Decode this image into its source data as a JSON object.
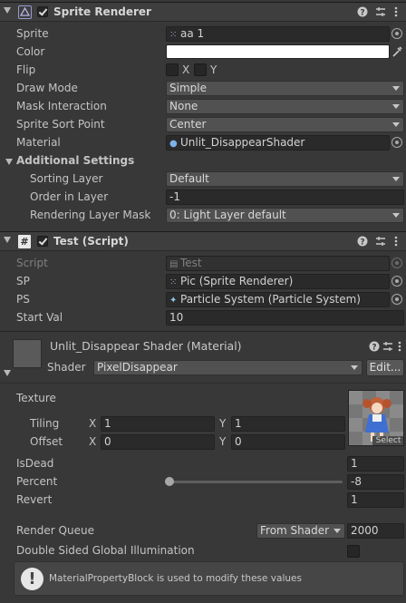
{
  "sprite_renderer": {
    "title": "Sprite Renderer",
    "enabled": true,
    "fields": {
      "sprite_label": "Sprite",
      "sprite_value": "aa 1",
      "color_label": "Color",
      "color_value": "#FFFFFF",
      "flip_label": "Flip",
      "flip_x": "X",
      "flip_y": "Y",
      "draw_mode_label": "Draw Mode",
      "draw_mode_value": "Simple",
      "mask_label": "Mask Interaction",
      "mask_value": "None",
      "sort_point_label": "Sprite Sort Point",
      "sort_point_value": "Center",
      "material_label": "Material",
      "material_value": "Unlit_DisappearShader"
    },
    "additional": {
      "title": "Additional Settings",
      "sorting_layer_label": "Sorting Layer",
      "sorting_layer_value": "Default",
      "order_label": "Order in Layer",
      "order_value": "-1",
      "rendering_layer_label": "Rendering Layer Mask",
      "rendering_layer_value": "0: Light Layer default"
    }
  },
  "test_script": {
    "title": "Test (Script)",
    "enabled": true,
    "script_label": "Script",
    "script_value": "Test",
    "sp_label": "SP",
    "sp_value": "Pic (Sprite Renderer)",
    "ps_label": "PS",
    "ps_value": "Particle System (Particle System)",
    "start_label": "Start Val",
    "start_value": "10"
  },
  "material": {
    "title": "Unlit_Disappear Shader (Material)",
    "shader_label": "Shader",
    "shader_value": "PixelDisappear",
    "edit_label": "Edit...",
    "texture_label": "Texture",
    "select_label": "Select",
    "tiling_label": "Tiling",
    "tiling_x": "1",
    "tiling_y": "1",
    "offset_label": "Offset",
    "offset_x": "0",
    "offset_y": "0",
    "axis_x": "X",
    "axis_y": "Y",
    "isdead_label": "IsDead",
    "isdead_value": "1",
    "percent_label": "Percent",
    "percent_value": "-8",
    "percent_slider_fraction": 0.0,
    "revert_label": "Revert",
    "revert_value": "1",
    "queue_label": "Render Queue",
    "queue_mode": "From Shader",
    "queue_value": "2000",
    "dsgi_label": "Double Sided Global Illumination",
    "info_text": "MaterialPropertyBlock is used to modify these values"
  }
}
